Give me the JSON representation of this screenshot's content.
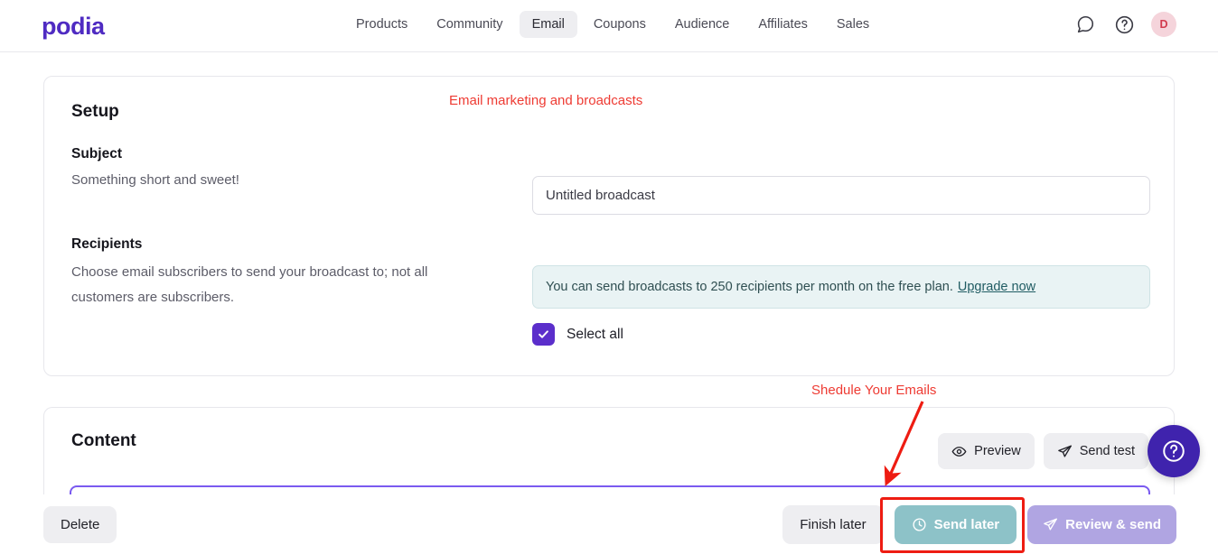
{
  "brand": {
    "name": "podia"
  },
  "nav": {
    "items": [
      {
        "label": "Products",
        "active": false
      },
      {
        "label": "Community",
        "active": false
      },
      {
        "label": "Email",
        "active": true
      },
      {
        "label": "Coupons",
        "active": false
      },
      {
        "label": "Audience",
        "active": false
      },
      {
        "label": "Affiliates",
        "active": false
      },
      {
        "label": "Sales",
        "active": false
      }
    ],
    "icons": {
      "chat": "chat-bubble-icon",
      "help": "question-circle-icon"
    },
    "avatar_initial": "D"
  },
  "setup": {
    "title": "Setup",
    "subject_label": "Subject",
    "subject_hint": "Something short and sweet!",
    "subject_value": "Untitled broadcast",
    "subject_placeholder": "Untitled broadcast",
    "recipients_label": "Recipients",
    "recipients_hint": "Choose email subscribers to send your broadcast to; not all customers are subscribers.",
    "notice_text": "You can send broadcasts to 250 recipients per month on the free plan.",
    "notice_link": "Upgrade now",
    "select_all_label": "Select all",
    "select_all_checked": true
  },
  "content": {
    "title": "Content",
    "preview_label": "Preview",
    "send_test_label": "Send test"
  },
  "footer": {
    "delete_label": "Delete",
    "finish_later_label": "Finish later",
    "send_later_label": "Send later",
    "review_send_label": "Review & send"
  },
  "annotations": {
    "top_note": "Email marketing and broadcasts",
    "schedule_note": "Shedule Your Emails"
  },
  "colors": {
    "brand_purple": "#4f2bc2",
    "checkbox_purple": "#5b2ecb",
    "notice_bg": "#e9f3f4",
    "send_later_teal": "#8dc2c8",
    "review_send_lilac": "#b0a5e2",
    "annotation_red": "#ee3b33",
    "highlight_red": "#ee1c12",
    "avatar_bg": "#f5d4db",
    "avatar_fg": "#d23b4e",
    "fab_purple": "#3f23ad",
    "editor_border": "#7a5af0"
  }
}
